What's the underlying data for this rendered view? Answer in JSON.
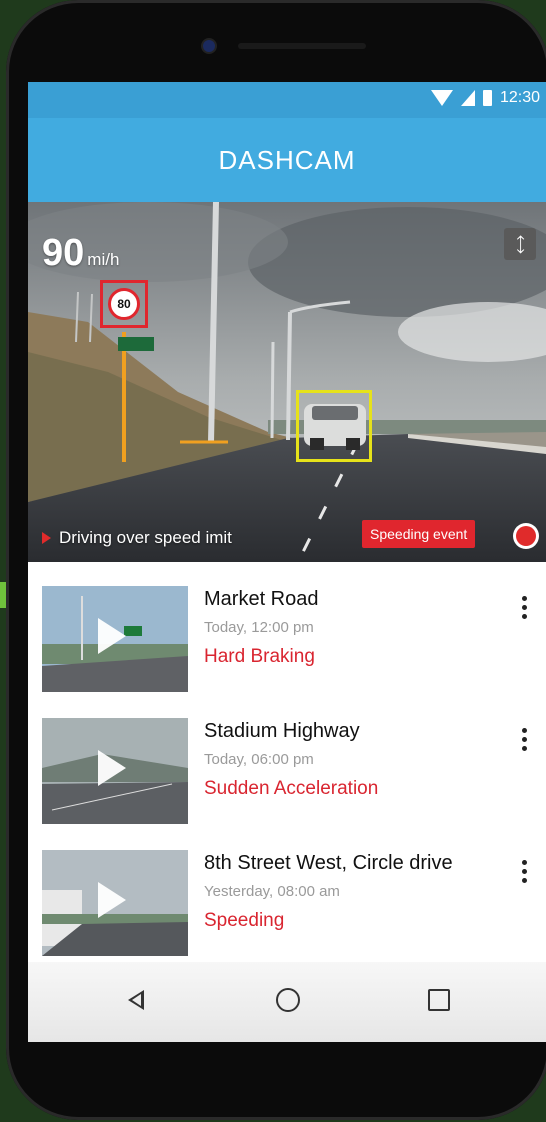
{
  "status": {
    "time": "12:30"
  },
  "app": {
    "title": "DASHCAM"
  },
  "camera": {
    "speed_value": "90",
    "speed_unit": "mi/h",
    "sign_limit": "80",
    "alert_text": "Driving over speed  imit",
    "event_badge": "Speeding event"
  },
  "events": [
    {
      "location": "Market Road",
      "time": "Today, 12:00 pm",
      "type": "Hard Braking"
    },
    {
      "location": "Stadium Highway",
      "time": "Today, 06:00 pm",
      "type": "Sudden Acceleration"
    },
    {
      "location": "8th Street West, Circle drive",
      "time": "Yesterday, 08:00 am",
      "type": "Speeding"
    }
  ],
  "colors": {
    "appbar": "#41abe0",
    "statusbar": "#3a9fd4",
    "alert_red": "#e0262e",
    "event_text": "#d92530"
  },
  "icons": [
    "wifi-icon",
    "signal-icon",
    "battery-icon",
    "expand-icon",
    "play-icon",
    "more-vert-icon",
    "nav-back-icon",
    "nav-home-icon",
    "nav-recents-icon",
    "record-icon"
  ]
}
